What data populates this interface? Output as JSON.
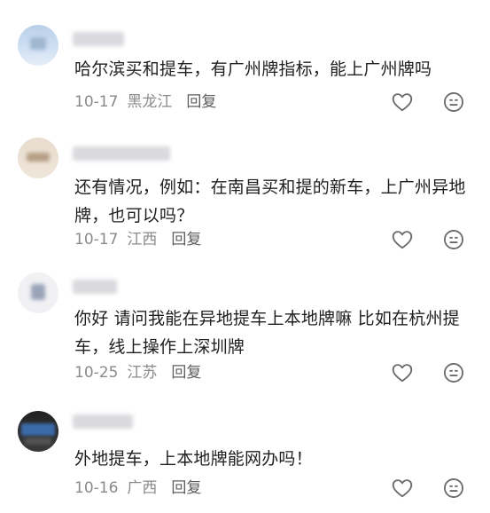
{
  "comments": [
    {
      "text": "哈尔滨买和提车，有广州牌指标，能上广州牌吗",
      "date": "10-17",
      "location": "黑龙江",
      "reply_label": "回复"
    },
    {
      "text": "还有情况，例如：在南昌买和提的新车，上广州异地牌，也可以吗？",
      "date": "10-17",
      "location": "江西",
      "reply_label": "回复"
    },
    {
      "text": "你好 请问我能在异地提车上本地牌嘛 比如在杭州提车，线上操作上深圳牌",
      "date": "10-25",
      "location": "江苏",
      "reply_label": "回复"
    },
    {
      "text": "外地提车，上本地牌能网办吗！",
      "date": "10-16",
      "location": "广西",
      "reply_label": "回复"
    }
  ],
  "icons": {
    "like": "heart-outline-icon",
    "dislike": "neutral-face-icon"
  },
  "colors": {
    "text": "#1f1f1f",
    "meta": "#8a8a8a",
    "icon": "#6b6b6b"
  }
}
